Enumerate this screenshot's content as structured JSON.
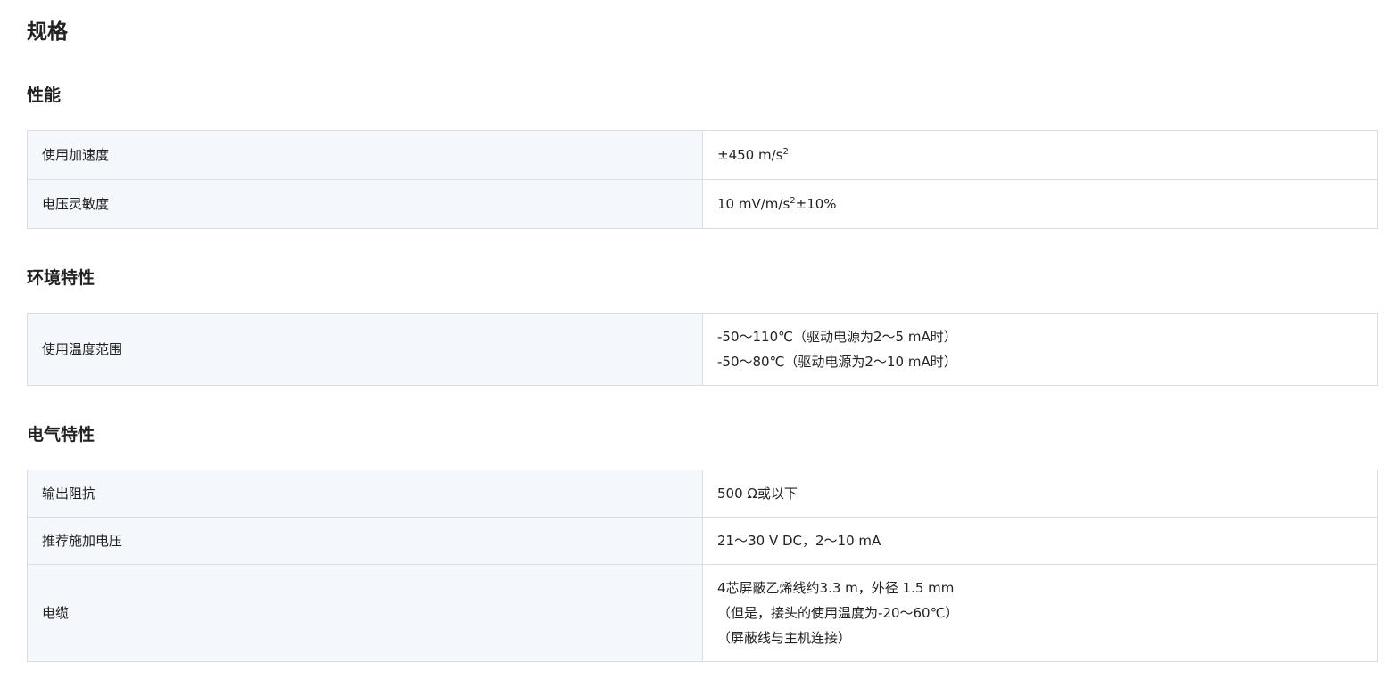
{
  "title": "规格",
  "sections": {
    "performance": {
      "title": "性能",
      "rows": [
        {
          "label": "使用加速度",
          "value_prefix": "±450 m/s",
          "value_sup": "2",
          "value_suffix": ""
        },
        {
          "label": "电压灵敏度",
          "value_prefix": "10 mV/m/s",
          "value_sup": "2",
          "value_suffix": "±10%"
        }
      ]
    },
    "environment": {
      "title": "环境特性",
      "rows": [
        {
          "label": "使用温度范围",
          "lines": [
            "-50～110℃（驱动电源为2～5 mA时）",
            "-50～80℃（驱动电源为2～10 mA时）"
          ]
        }
      ]
    },
    "electrical": {
      "title": "电气特性",
      "rows": [
        {
          "label": "输出阻抗",
          "lines": [
            "500 Ω或以下"
          ]
        },
        {
          "label": "推荐施加电压",
          "lines": [
            "21～30 V DC，2～10 mA"
          ]
        },
        {
          "label": "电缆",
          "lines": [
            "4芯屏蔽乙烯线约3.3 m，外径 1.5 mm",
            "（但是，接头的使用温度为-20～60℃）",
            "（屏蔽线与主机连接）"
          ]
        }
      ]
    }
  }
}
